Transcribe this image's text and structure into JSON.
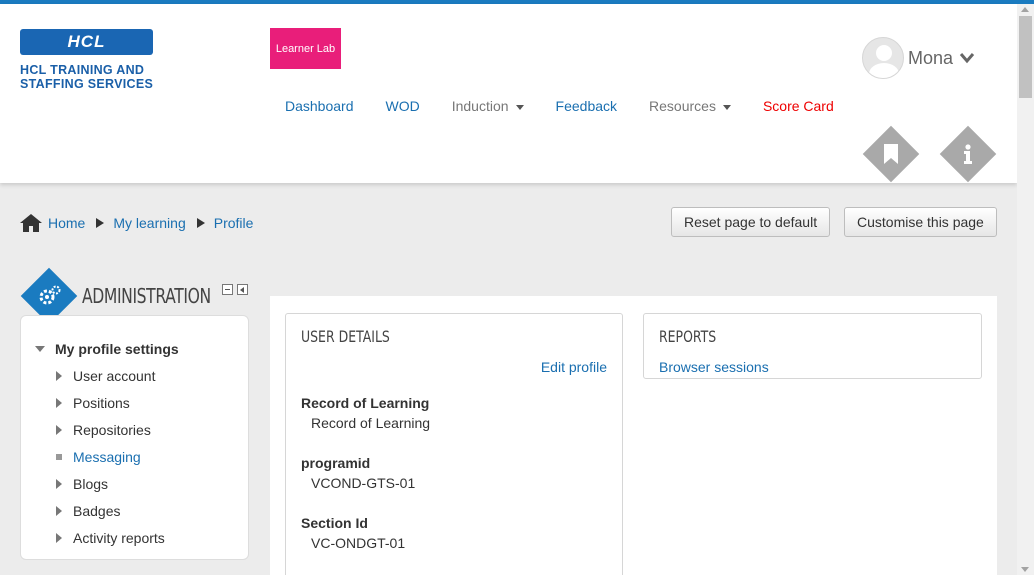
{
  "header": {
    "logo": {
      "brand": "HCL",
      "line1": "HCL TRAINING AND",
      "line2": "STAFFING SERVICES"
    },
    "learner_lab": "Learner Lab",
    "user": {
      "name": "Mona"
    },
    "nav": [
      {
        "label": "Dashboard",
        "color": "blue"
      },
      {
        "label": "WOD",
        "color": "blue"
      },
      {
        "label": "Induction",
        "color": "grey",
        "dropdown": true
      },
      {
        "label": "Feedback",
        "color": "blue"
      },
      {
        "label": "Resources",
        "color": "grey",
        "dropdown": true
      },
      {
        "label": "Score Card",
        "color": "red"
      }
    ],
    "icons": [
      "bookmark-icon",
      "info-icon"
    ]
  },
  "breadcrumb": {
    "home": "Home",
    "items": [
      "My learning",
      "Profile"
    ]
  },
  "buttons": {
    "reset": "Reset page to default",
    "customise": "Customise this page"
  },
  "administration": {
    "title": "ADMINISTRATION",
    "root": "My profile settings",
    "items": [
      {
        "label": "User account",
        "type": "expandable"
      },
      {
        "label": "Positions",
        "type": "expandable"
      },
      {
        "label": "Repositories",
        "type": "expandable"
      },
      {
        "label": "Messaging",
        "type": "link"
      },
      {
        "label": "Blogs",
        "type": "expandable"
      },
      {
        "label": "Badges",
        "type": "expandable"
      },
      {
        "label": "Activity reports",
        "type": "expandable"
      }
    ]
  },
  "user_details": {
    "title": "USER DETAILS",
    "edit_profile": "Edit profile",
    "fields": [
      {
        "label": "Record of Learning",
        "value": "Record of Learning",
        "is_link": true
      },
      {
        "label": "programid",
        "value": "VCOND-GTS-01",
        "is_link": false
      },
      {
        "label": "Section Id",
        "value": "VC-ONDGT-01",
        "is_link": false
      }
    ]
  },
  "reports": {
    "title": "REPORTS",
    "link": "Browser sessions"
  },
  "colors": {
    "accent": "#1a7bc0",
    "learner_lab": "#e91e7a",
    "score_card": "#ee0000",
    "link": "#1a6fb0"
  }
}
